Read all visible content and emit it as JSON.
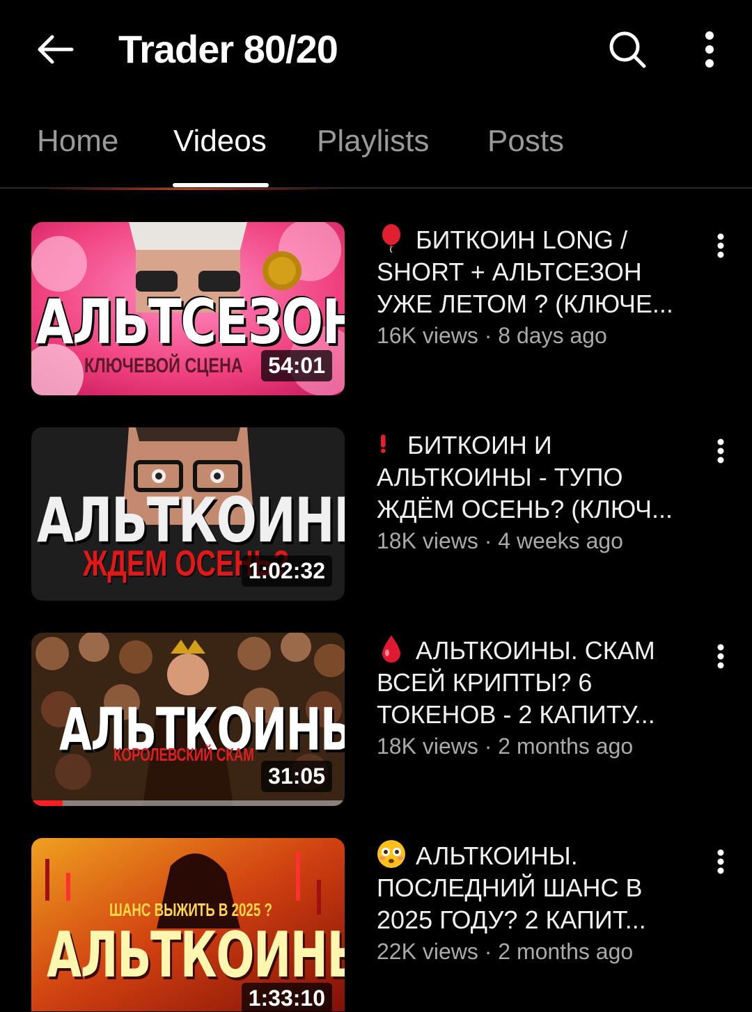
{
  "header": {
    "back_icon": "arrow-left-icon",
    "channel_name": "Trader 80/20",
    "search_icon": "search-icon",
    "more_icon": "more-vert-icon"
  },
  "tabs": [
    {
      "label": "Home",
      "active": false
    },
    {
      "label": "Videos",
      "active": true
    },
    {
      "label": "Playlists",
      "active": false
    },
    {
      "label": "Posts",
      "active": false
    }
  ],
  "videos": [
    {
      "emoji": "balloon",
      "title": "БИТКОИН LONG / SHORT + АЛЬТСЕЗОН УЖЕ ЛЕТОМ ? (КЛЮЧЕ...",
      "views": "16K views",
      "age": "8 days ago",
      "duration": "54:01",
      "thumb_text": "АЛЬТСЕЗОН",
      "thumb_subtext": "КЛЮЧЕВОЙ СЦЕНА",
      "watched_fraction": 0
    },
    {
      "emoji": "exclamation",
      "title": "БИТКОИН И АЛЬТКОИНЫ - ТУПО ЖДЁМ ОСЕНЬ? (КЛЮЧ...",
      "views": "18K views",
      "age": "4 weeks ago",
      "duration": "1:02:32",
      "thumb_text": "АЛЬТКОИНЫ",
      "thumb_subtext": "ЖДЕМ ОСЕНЬ?",
      "watched_fraction": 0
    },
    {
      "emoji": "drop",
      "title": "АЛЬТКОИНЫ. СКАМ ВСЕЙ КРИПТЫ? 6 ТОКЕНОВ - 2 КАПИТУ...",
      "views": "18K views",
      "age": "2 months ago",
      "duration": "31:05",
      "thumb_text": "АЛЬТКОИНЫ",
      "thumb_subtext": "КОРОЛЕВСКИЙ СКАМ",
      "watched_fraction": 0.1
    },
    {
      "emoji": "flushed-face",
      "title": "АЛЬТКОИНЫ. ПОСЛЕДНИЙ ШАНС В 2025 ГОДУ? 2 КАПИТ...",
      "views": "22K views",
      "age": "2 months ago",
      "duration": "1:33:10",
      "thumb_text": "АЛЬТКОИНЫ",
      "thumb_subtext": "ШАНС ВЫЖИТЬ В 2025 ?",
      "watched_fraction": 0
    }
  ],
  "stats_separator": " · ",
  "colors": {
    "background": "#000000",
    "text_primary": "#f1f1f1",
    "text_secondary": "#aaaaaa",
    "progress_red": "#ff1f1f"
  }
}
